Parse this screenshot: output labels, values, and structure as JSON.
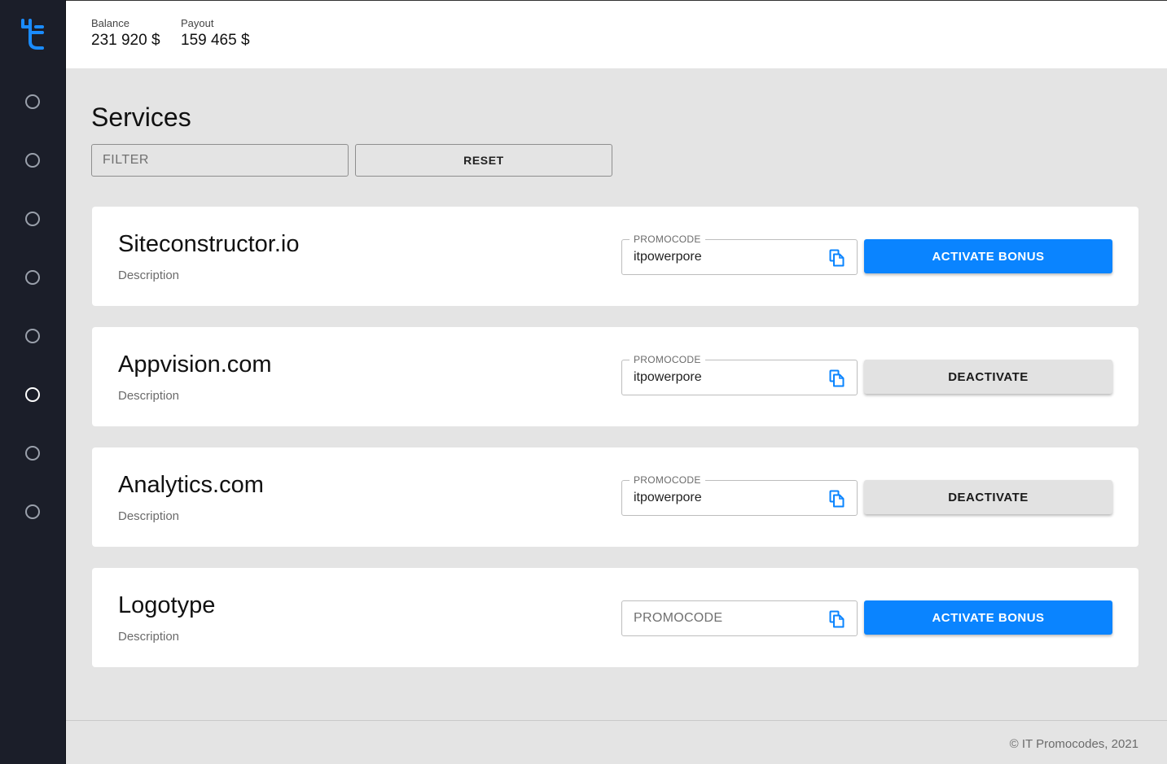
{
  "header": {
    "balance": {
      "label": "Balance",
      "value": "231 920 $"
    },
    "payout": {
      "label": "Payout",
      "value": "159 465 $"
    }
  },
  "sidebar": {
    "logo_icon": "t-logo-icon",
    "items": [
      {
        "name": "nav-item-1",
        "active": false
      },
      {
        "name": "nav-item-2",
        "active": false
      },
      {
        "name": "nav-item-3",
        "active": false
      },
      {
        "name": "nav-item-4",
        "active": false
      },
      {
        "name": "nav-item-5",
        "active": false
      },
      {
        "name": "nav-item-6",
        "active": true
      },
      {
        "name": "nav-item-7",
        "active": false
      },
      {
        "name": "nav-item-8",
        "active": false
      }
    ]
  },
  "main": {
    "title": "Services",
    "filter": {
      "placeholder": "FILTER",
      "value": ""
    },
    "reset_label": "RESET",
    "services": [
      {
        "name": "Siteconstructor.io",
        "description": "Description",
        "promo_label": "PROMOCODE",
        "promocode": "itpowerpore",
        "action_label": "ACTIVATE BONUS",
        "action_type": "primary"
      },
      {
        "name": "Appvision.com",
        "description": "Description",
        "promo_label": "PROMOCODE",
        "promocode": "itpowerpore",
        "action_label": "DEACTIVATE",
        "action_type": "secondary"
      },
      {
        "name": "Analytics.com",
        "description": "Description",
        "promo_label": "PROMOCODE",
        "promocode": "itpowerpore",
        "action_label": "DEACTIVATE",
        "action_type": "secondary"
      },
      {
        "name": "Logotype",
        "description": "Description",
        "promo_placeholder": "PROMOCODE",
        "promocode": "",
        "action_label": "ACTIVATE BONUS",
        "action_type": "primary"
      }
    ]
  },
  "footer": {
    "text": "© IT Promocodes, 2021"
  },
  "colors": {
    "sidebar_bg": "#1b1e29",
    "accent": "#0a84ff",
    "page_bg": "#e4e4e4",
    "card_bg": "#ffffff",
    "secondary_button": "#e2e2e2"
  }
}
